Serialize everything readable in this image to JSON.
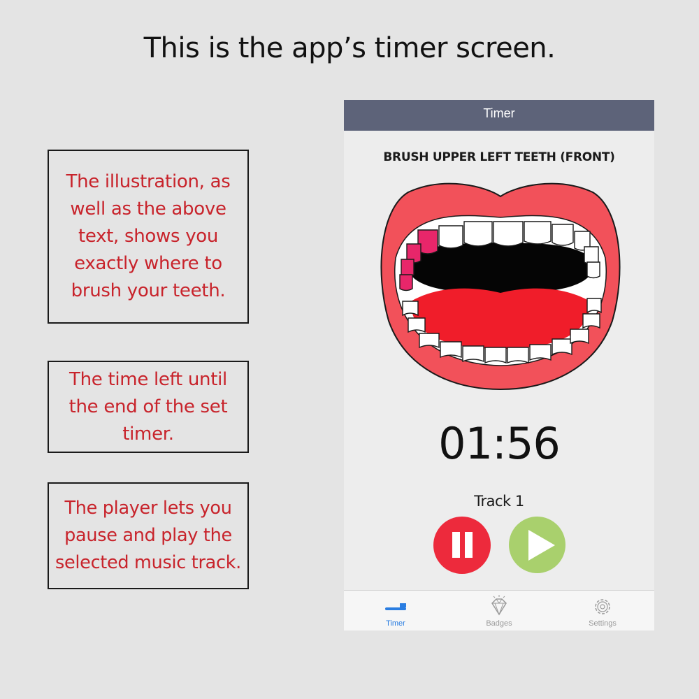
{
  "headline": "This is the app’s timer screen.",
  "notes": {
    "illustration": "The illustration, as well as the above text, shows you exactly where to brush your teeth.",
    "time_left": "The time left until the end of the set timer.",
    "player": "The player lets you pause and play the selected music track."
  },
  "app": {
    "nav_title": "Timer",
    "instruction": "BRUSH UPPER LEFT TEETH (FRONT)",
    "countdown": "01:56",
    "track": "Track 1",
    "tabs": [
      {
        "label": "Timer",
        "icon": "toothbrush-icon",
        "active": true
      },
      {
        "label": "Badges",
        "icon": "diamond-icon",
        "active": false
      },
      {
        "label": "Settings",
        "icon": "gear-icon",
        "active": false
      }
    ]
  },
  "colors": {
    "note_text": "#c8232b",
    "navbar": "#5d6379",
    "pause": "#ed2a3c",
    "play": "#a9d06d",
    "lips": "#f2515a",
    "highlight_teeth": "#e8266a",
    "tab_active": "#2a7de1"
  }
}
